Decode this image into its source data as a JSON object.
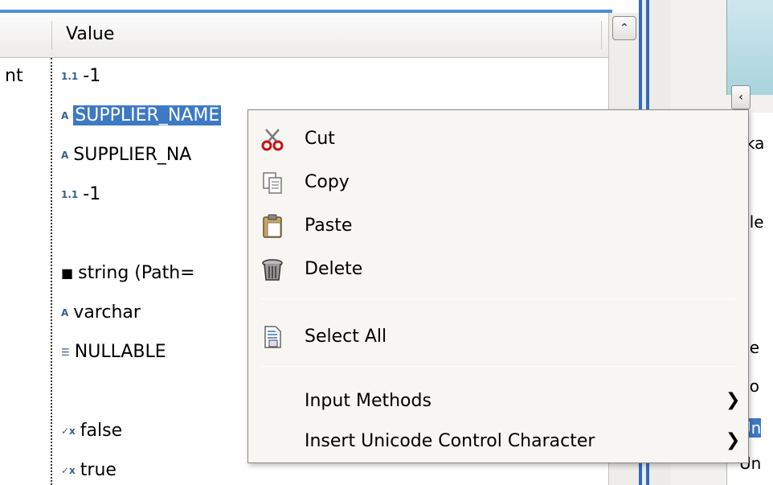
{
  "table": {
    "header_value": "Value",
    "rows": [
      {
        "name": "nt",
        "icon": "number-icon",
        "value": "-1",
        "selected": false
      },
      {
        "name": "",
        "icon": "text-icon",
        "value": "SUPPLIER_NAME",
        "selected": true
      },
      {
        "name": "",
        "icon": "text-icon",
        "value": "SUPPLIER_NA",
        "selected": false
      },
      {
        "name": "",
        "icon": "number-icon",
        "value": "-1",
        "selected": false
      },
      {
        "name": "",
        "icon": "",
        "value": "",
        "selected": false
      },
      {
        "name": "",
        "icon": "object-icon",
        "value": "string (Path=",
        "selected": false
      },
      {
        "name": "",
        "icon": "text-icon",
        "value": "varchar",
        "selected": false
      },
      {
        "name": "",
        "icon": "list-icon",
        "value": "NULLABLE",
        "selected": false
      },
      {
        "name": "",
        "icon": "",
        "value": "",
        "selected": false
      },
      {
        "name": "",
        "icon": "boolean-icon",
        "value": "false",
        "selected": false
      },
      {
        "name": "",
        "icon": "boolean-icon",
        "value": "true",
        "selected": false
      }
    ]
  },
  "scrollbar": {
    "up_arrow": "⌃"
  },
  "right_pane": {
    "left_arrow": "‹",
    "fragments": [
      "tka",
      "ble",
      "ge",
      "So",
      "Un",
      "Un"
    ]
  },
  "context_menu": {
    "items": [
      {
        "label": "Cut",
        "icon": "scissors-icon",
        "submenu": false
      },
      {
        "label": "Copy",
        "icon": "copy-icon",
        "submenu": false
      },
      {
        "label": "Paste",
        "icon": "paste-icon",
        "submenu": false
      },
      {
        "label": "Delete",
        "icon": "trash-icon",
        "submenu": false
      },
      {
        "label": "Select All",
        "icon": "select-all-icon",
        "submenu": false
      },
      {
        "label": "Input Methods",
        "icon": "",
        "submenu": true
      },
      {
        "label": "Insert Unicode Control Character",
        "icon": "",
        "submenu": true
      }
    ],
    "submenu_arrow": "❯"
  },
  "colors": {
    "selection": "#3d79c4",
    "accent_bar": "#2f6cbf"
  }
}
